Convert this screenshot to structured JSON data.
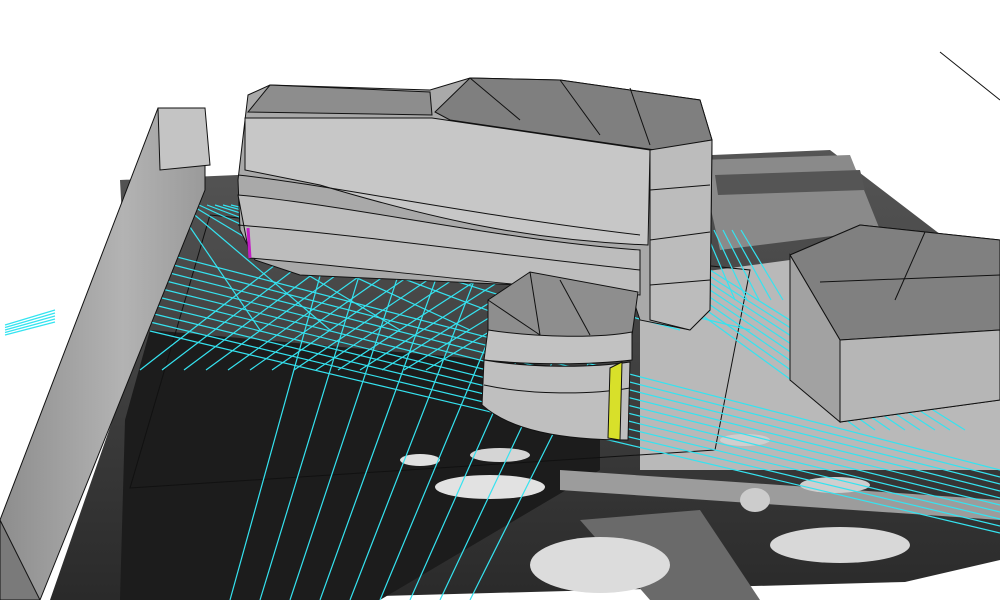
{
  "scene": {
    "background_color": "#ffffff",
    "ground_photo": "aerial-harbor-photo-grayscale",
    "guide_line_color": "#35e3f0",
    "edge_color": "#1a1a1a",
    "selection_edge_color": "#d8e02a",
    "highlight_edge_color": "#c21fc4"
  },
  "models": [
    {
      "name": "left-wall-block"
    },
    {
      "name": "curved-main-building"
    },
    {
      "name": "rotunda-wing"
    },
    {
      "name": "right-box-building"
    }
  ]
}
